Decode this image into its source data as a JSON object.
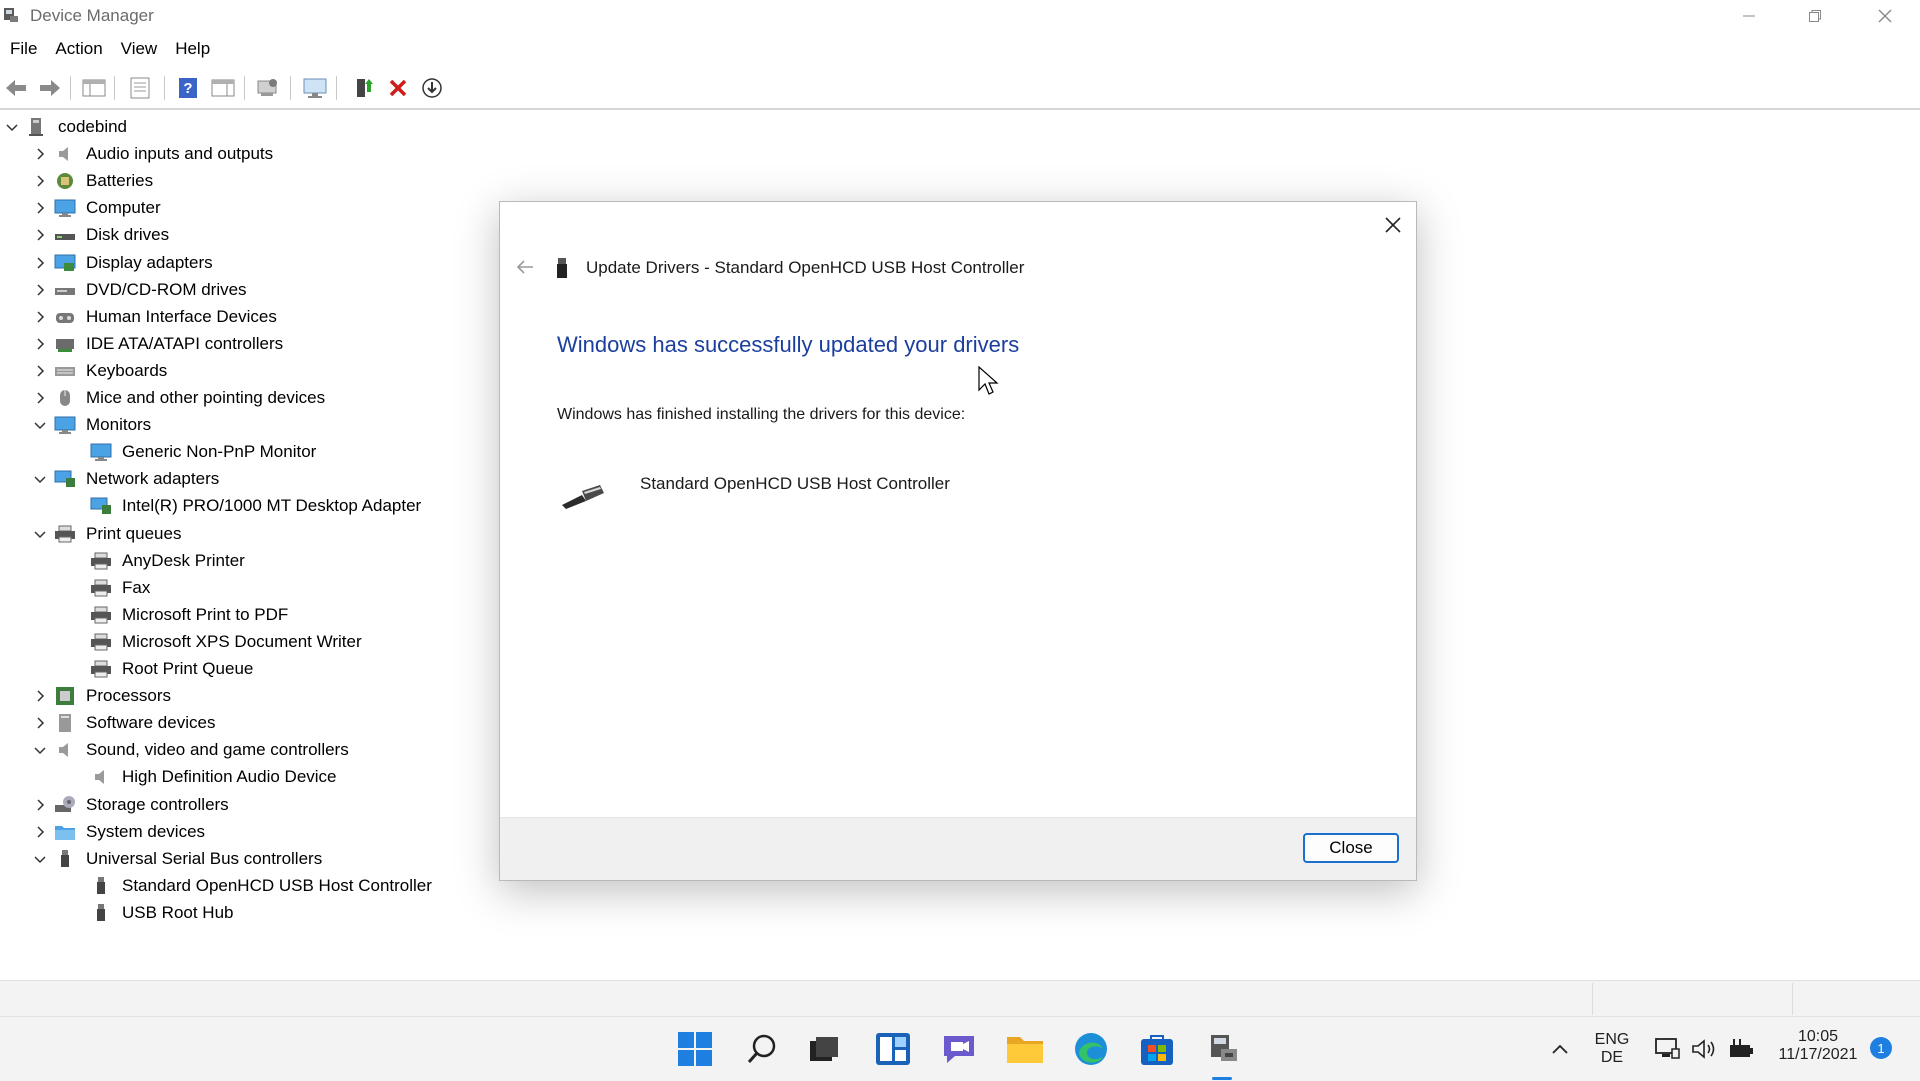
{
  "window": {
    "title": "Device Manager"
  },
  "menu": [
    "File",
    "Action",
    "View",
    "Help"
  ],
  "tree": {
    "root": "codebind",
    "items": [
      {
        "label": "Audio inputs and outputs",
        "level": 1,
        "expanded": false,
        "icon": "speaker-icon"
      },
      {
        "label": "Batteries",
        "level": 1,
        "expanded": false,
        "icon": "battery-icon"
      },
      {
        "label": "Computer",
        "level": 1,
        "expanded": false,
        "icon": "monitor-icon"
      },
      {
        "label": "Disk drives",
        "level": 1,
        "expanded": false,
        "icon": "disk-icon"
      },
      {
        "label": "Display adapters",
        "level": 1,
        "expanded": false,
        "icon": "display-adapter-icon"
      },
      {
        "label": "DVD/CD-ROM drives",
        "level": 1,
        "expanded": false,
        "icon": "dvd-icon"
      },
      {
        "label": "Human Interface Devices",
        "level": 1,
        "expanded": false,
        "icon": "hid-icon"
      },
      {
        "label": "IDE ATA/ATAPI controllers",
        "level": 1,
        "expanded": false,
        "icon": "ide-icon"
      },
      {
        "label": "Keyboards",
        "level": 1,
        "expanded": false,
        "icon": "keyboard-icon"
      },
      {
        "label": "Mice and other pointing devices",
        "level": 1,
        "expanded": false,
        "icon": "mouse-icon"
      },
      {
        "label": "Monitors",
        "level": 1,
        "expanded": true,
        "icon": "monitor-icon"
      },
      {
        "label": "Generic Non-PnP Monitor",
        "level": 2,
        "icon": "monitor-icon"
      },
      {
        "label": "Network adapters",
        "level": 1,
        "expanded": true,
        "icon": "network-icon"
      },
      {
        "label": "Intel(R) PRO/1000 MT Desktop Adapter",
        "level": 2,
        "icon": "network-icon"
      },
      {
        "label": "Print queues",
        "level": 1,
        "expanded": true,
        "icon": "printer-icon"
      },
      {
        "label": "AnyDesk Printer",
        "level": 2,
        "icon": "printer-icon"
      },
      {
        "label": "Fax",
        "level": 2,
        "icon": "printer-icon"
      },
      {
        "label": "Microsoft Print to PDF",
        "level": 2,
        "icon": "printer-icon"
      },
      {
        "label": "Microsoft XPS Document Writer",
        "level": 2,
        "icon": "printer-icon"
      },
      {
        "label": "Root Print Queue",
        "level": 2,
        "icon": "printer-icon"
      },
      {
        "label": "Processors",
        "level": 1,
        "expanded": false,
        "icon": "processor-icon"
      },
      {
        "label": "Software devices",
        "level": 1,
        "expanded": false,
        "icon": "software-icon"
      },
      {
        "label": "Sound, video and game controllers",
        "level": 1,
        "expanded": true,
        "icon": "speaker-icon"
      },
      {
        "label": "High Definition Audio Device",
        "level": 2,
        "icon": "speaker-icon"
      },
      {
        "label": "Storage controllers",
        "level": 1,
        "expanded": false,
        "icon": "storage-icon"
      },
      {
        "label": "System devices",
        "level": 1,
        "expanded": false,
        "icon": "system-folder-icon"
      },
      {
        "label": "Universal Serial Bus controllers",
        "level": 1,
        "expanded": true,
        "icon": "usb-icon"
      },
      {
        "label": "Standard OpenHCD USB Host Controller",
        "level": 2,
        "icon": "usb-icon"
      },
      {
        "label": "USB Root Hub",
        "level": 2,
        "icon": "usb-icon"
      }
    ]
  },
  "dialog": {
    "title": "Update Drivers - Standard OpenHCD USB Host Controller",
    "heading": "Windows has successfully updated your drivers",
    "message": "Windows has finished installing the drivers for this device:",
    "device_name": "Standard OpenHCD USB Host Controller",
    "close_button": "Close"
  },
  "taskbar": {
    "lang_top": "ENG",
    "lang_bottom": "DE",
    "time": "10:05",
    "date": "11/17/2021",
    "notification_count": "1"
  },
  "colors": {
    "heading": "#1c3f9e",
    "accent": "#1a6fcf",
    "delete_red": "#d11a1a"
  }
}
